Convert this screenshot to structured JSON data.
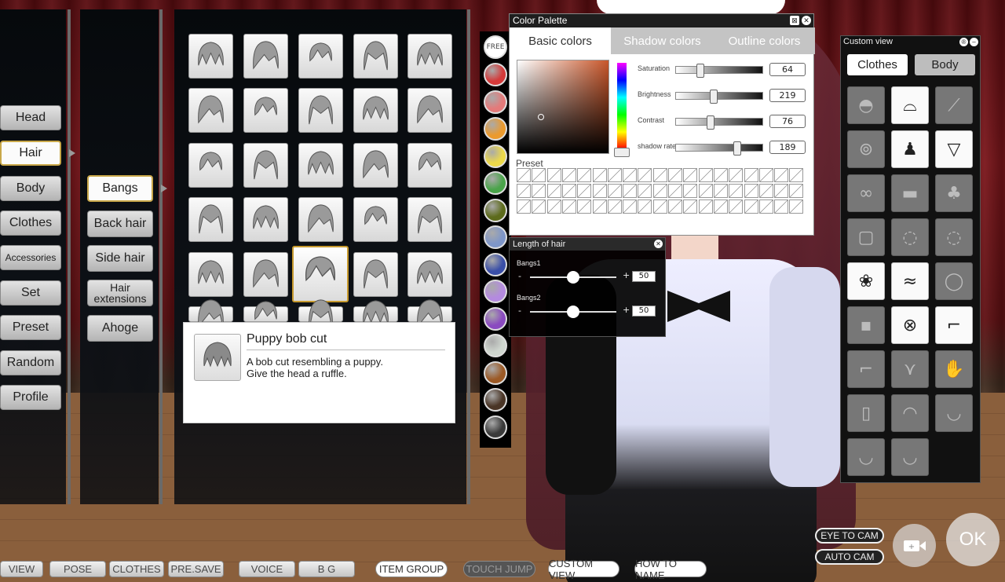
{
  "categories": [
    "Head",
    "Hair",
    "Body",
    "Clothes",
    "Accessories",
    "Set",
    "Preset",
    "Random",
    "Profile"
  ],
  "selected_category": "Hair",
  "subcategories": [
    {
      "label": "Bangs"
    },
    {
      "label": "Back hair"
    },
    {
      "label": "Side hair"
    },
    {
      "label": "Hair\nextensions"
    },
    {
      "label": "Ahoge"
    }
  ],
  "selected_subcategory": "Bangs",
  "tooltip": {
    "title": "Puppy bob cut",
    "description_line1": "A bob cut resembling a puppy.",
    "description_line2": "Give the head a ruffle."
  },
  "swatches": {
    "free_label": "FREE",
    "colors": [
      "#d43a3a",
      "#e47a7a",
      "#eb9a2e",
      "#ecd94a",
      "#4aa44a",
      "#5d6b1c",
      "#7e96c8",
      "#3a4fa8",
      "#b48ae0",
      "#8a4ac0",
      "#cfd6cf",
      "#9c5a26",
      "#4a3526",
      "#3a3a3a"
    ]
  },
  "color_palette": {
    "title": "Color Palette",
    "tabs": [
      "Basic colors",
      "Shadow colors",
      "Outline colors"
    ],
    "active_tab": "Basic colors",
    "preset_label": "Preset",
    "sliders": [
      {
        "label": "Saturation",
        "value": "64",
        "frac": 0.25
      },
      {
        "label": "Brightness",
        "value": "219",
        "frac": 0.42
      },
      {
        "label": "Contrast",
        "value": "76",
        "frac": 0.38
      },
      {
        "label": "shadow rate",
        "value": "189",
        "frac": 0.72
      }
    ]
  },
  "hair_length": {
    "title": "Length of hair",
    "rows": [
      {
        "label": "Bangs1",
        "value": "50",
        "frac": 0.5
      },
      {
        "label": "Bangs2",
        "value": "50",
        "frac": 0.5
      }
    ],
    "minus": "-",
    "plus": "+"
  },
  "custom_view": {
    "title": "Custom view",
    "tabs": [
      "Clothes",
      "Body"
    ],
    "active_tab": "Clothes"
  },
  "bottom_bar": [
    "VIEW",
    "POSE",
    "CLOTHES",
    "PRE.SAVE",
    "VOICE",
    "B G",
    "ITEM GROUP",
    "TOUCH JUMP",
    "CUSTOM VIEW",
    "HOW TO NAME"
  ],
  "camera_buttons": [
    "EYE TO CAM",
    "AUTO CAM"
  ],
  "ok_label": "OK"
}
